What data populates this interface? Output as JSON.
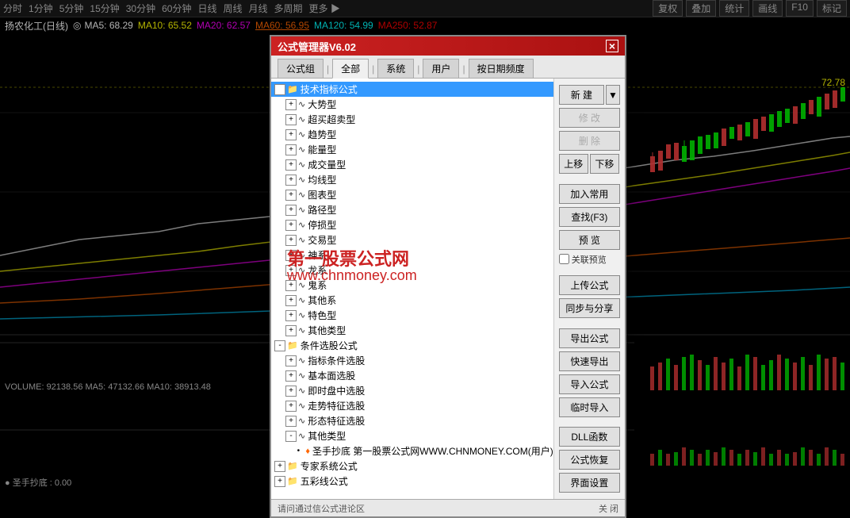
{
  "toolbar": {
    "items": [
      "分时",
      "1分钟",
      "5分钟",
      "15分钟",
      "30分钟",
      "60分钟",
      "日线",
      "周线",
      "月线",
      "多周期",
      "更多 ▶"
    ],
    "right_items": [
      "复权",
      "叠加",
      "统计",
      "画线",
      "F10",
      "标记"
    ]
  },
  "stock": {
    "name": "扬农化工(日线)",
    "indicator": "◎",
    "ma5": "MA5: 68.29",
    "ma10": "MA10: 65.52",
    "ma20": "MA20: 62.57",
    "ma60": "MA60: 56.95",
    "ma120": "MA120: 54.99",
    "ma250": "MA250: 52.87",
    "price": "72.78"
  },
  "volume": {
    "label": "VOLUME: 92138.56  MA5: 47132.66  MA10: 38913.48"
  },
  "bottom_indicator": {
    "label": "● 圣手抄底 : 0.00"
  },
  "dialog": {
    "title": "公式管理器V6.02",
    "close": "×",
    "tabs": [
      "公式组",
      "全部",
      "系统",
      "用户",
      "按日期频度"
    ],
    "tree": {
      "items": [
        {
          "level": 0,
          "expand": "-",
          "icon": "📁",
          "label": "技术指标公式",
          "selected": true
        },
        {
          "level": 1,
          "expand": "+",
          "icon": "∿",
          "label": "大势型"
        },
        {
          "level": 1,
          "expand": "+",
          "icon": "∿",
          "label": "超买超卖型"
        },
        {
          "level": 1,
          "expand": "+",
          "icon": "∿",
          "label": "趋势型"
        },
        {
          "level": 1,
          "expand": "+",
          "icon": "∿",
          "label": "能量型"
        },
        {
          "level": 1,
          "expand": "+",
          "icon": "∿",
          "label": "成交量型"
        },
        {
          "level": 1,
          "expand": "+",
          "icon": "∿",
          "label": "均线型"
        },
        {
          "level": 1,
          "expand": "+",
          "icon": "∿",
          "label": "图表型"
        },
        {
          "level": 1,
          "expand": "+",
          "icon": "∿",
          "label": "路径型"
        },
        {
          "level": 1,
          "expand": "+",
          "icon": "∿",
          "label": "停损型"
        },
        {
          "level": 1,
          "expand": "+",
          "icon": "∿",
          "label": "交易型"
        },
        {
          "level": 1,
          "expand": "+",
          "icon": "∿",
          "label": "神系"
        },
        {
          "level": 1,
          "expand": "+",
          "icon": "∿",
          "label": "龙系"
        },
        {
          "level": 1,
          "expand": "+",
          "icon": "∿",
          "label": "鬼系"
        },
        {
          "level": 1,
          "expand": "+",
          "icon": "∿",
          "label": "其他系"
        },
        {
          "level": 1,
          "expand": "+",
          "icon": "∿",
          "label": "特色型"
        },
        {
          "level": 1,
          "expand": "+",
          "icon": "∿",
          "label": "其他类型"
        },
        {
          "level": 0,
          "expand": "-",
          "icon": "📁",
          "label": "条件选股公式"
        },
        {
          "level": 1,
          "expand": "+",
          "icon": "∿",
          "label": "指标条件选股"
        },
        {
          "level": 1,
          "expand": "+",
          "icon": "∿",
          "label": "基本面选股"
        },
        {
          "level": 1,
          "expand": "+",
          "icon": "∿",
          "label": "即时盘中选股"
        },
        {
          "level": 1,
          "expand": "+",
          "icon": "∿",
          "label": "走势特征选股"
        },
        {
          "level": 1,
          "expand": "+",
          "icon": "∿",
          "label": "形态特征选股"
        },
        {
          "level": 1,
          "expand": "-",
          "icon": "∿",
          "label": "其他类型"
        },
        {
          "level": 2,
          "expand": "•",
          "icon": "♦",
          "label": "圣手抄底  第一股票公式网WWW.CHNMONEY.COM(用户)"
        },
        {
          "level": 0,
          "expand": "+",
          "icon": "📁",
          "label": "专家系统公式"
        },
        {
          "level": 0,
          "expand": "+",
          "icon": "📁",
          "label": "五彩线公式"
        }
      ]
    },
    "watermark1": "第一股票公式网",
    "watermark2": "www.chnmoney.com",
    "buttons": {
      "new": "新  建",
      "modify": "修  改",
      "delete": "删  除",
      "up": "上移",
      "down": "下移",
      "add_favorite": "加入常用",
      "search": "查找(F3)",
      "preview": "预  览",
      "link_preview": "关联预览",
      "upload": "上传公式",
      "sync": "同步与分享",
      "export": "导出公式",
      "quick_export": "快速导出",
      "import": "导入公式",
      "temp_import": "临时导入",
      "dll": "DLL函数",
      "restore": "公式恢复",
      "ui_settings": "界面设置",
      "close": "关  闭"
    },
    "footer": "请问通过信公式进论区"
  }
}
